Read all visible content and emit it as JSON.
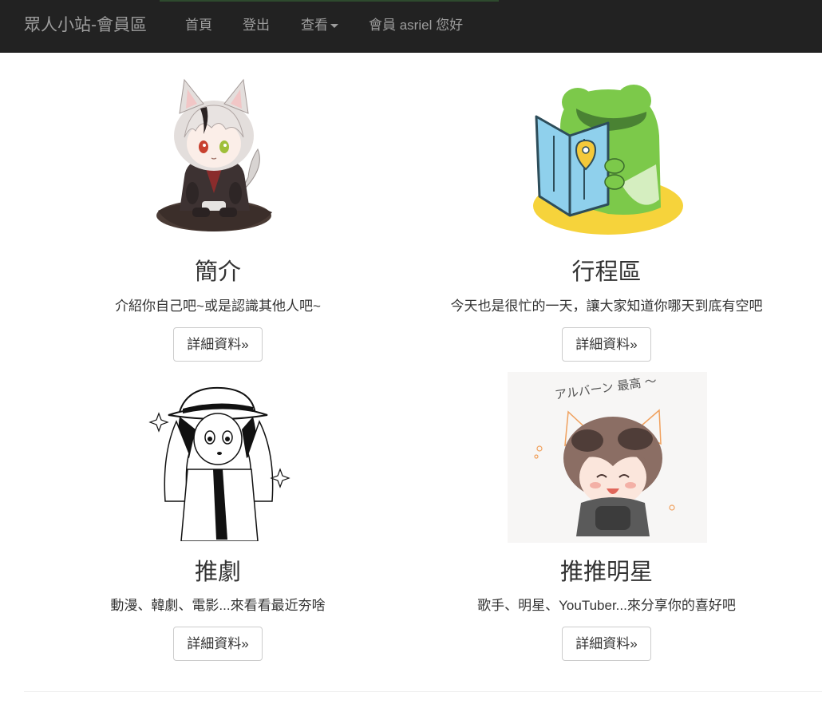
{
  "navbar": {
    "brand": "眾人小站-會員區",
    "links": [
      {
        "label": "首頁"
      },
      {
        "label": "登出"
      },
      {
        "label": "查看"
      },
      {
        "label": "會員 asriel 您好"
      }
    ]
  },
  "cards": [
    {
      "title": "簡介",
      "description": "介紹你自己吧~或是認識其他人吧~",
      "button": "詳細資料»"
    },
    {
      "title": "行程區",
      "description": "今天也是很忙的一天，讓大家知道你哪天到底有空吧",
      "button": "詳細資料»"
    },
    {
      "title": "推劇",
      "description": "動漫、韓劇、電影...來看看最近夯啥",
      "button": "詳細資料»"
    },
    {
      "title": "推推明星",
      "description": "歌手、明星、YouTuber...來分享你的喜好吧",
      "button": "詳細資料»"
    }
  ],
  "images": {
    "card4_caption": "アルバーン 最高 ～"
  },
  "colors": {
    "navbar_bg": "#222222",
    "navbar_text": "#9d9d9d",
    "frog_green": "#7cc94a",
    "frog_yellow": "#f6d33b",
    "map_blue": "#8fd0ec"
  }
}
